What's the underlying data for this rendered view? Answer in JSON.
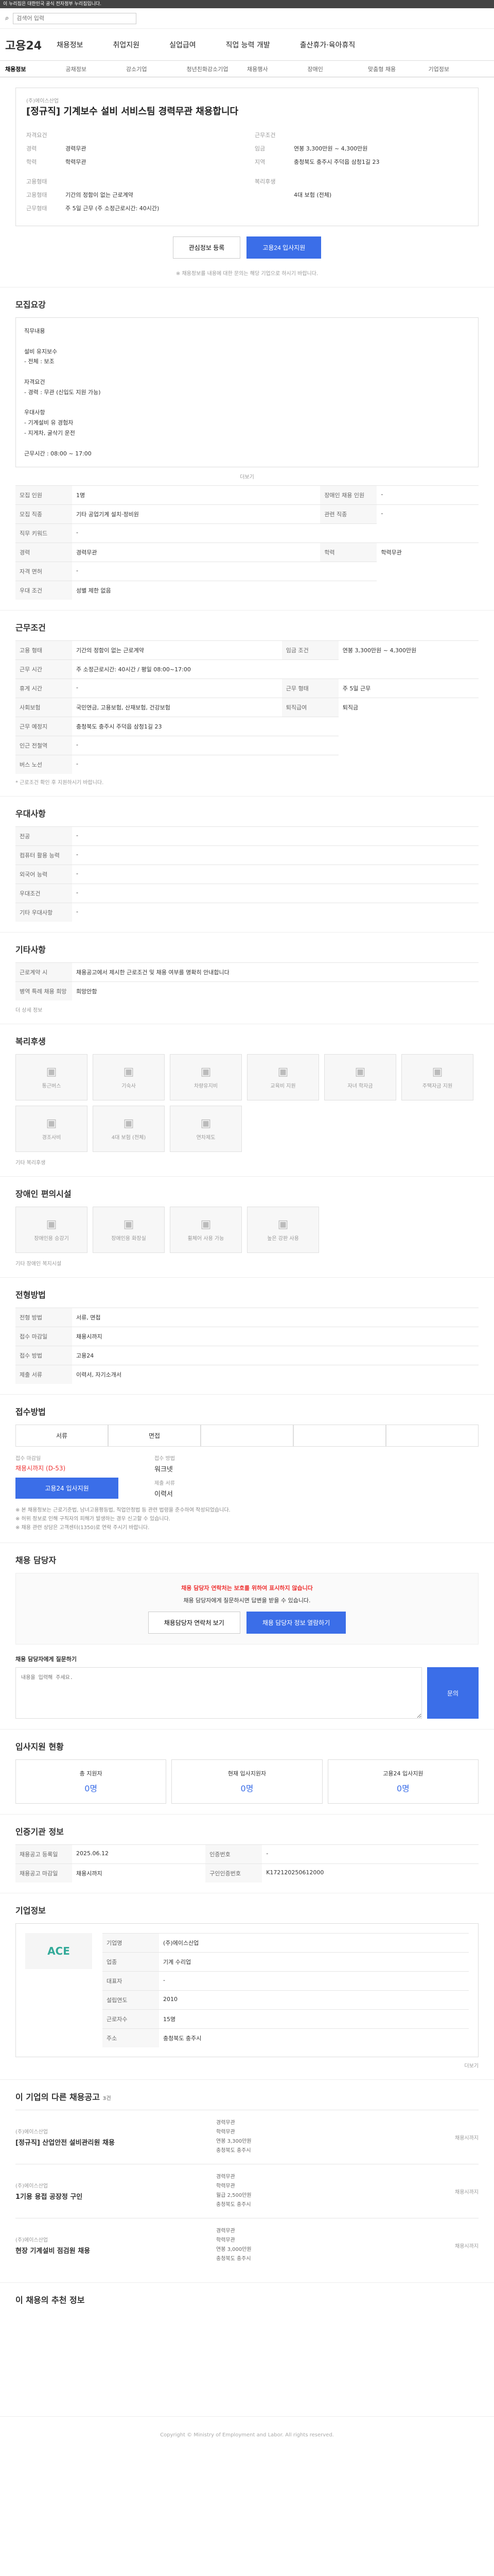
{
  "topbar": {
    "text": "이 누리집은 대한민국 공식 전자정부 누리집입니다."
  },
  "search": {
    "placeholder": "검색어 입력"
  },
  "gnb": {
    "logo": "고용24",
    "items": [
      "채용정보",
      "취업지원",
      "실업급여",
      "직업 능력 개발",
      "출산휴가·육아휴직"
    ]
  },
  "subnav": [
    "채용정보",
    "공채정보",
    "강소기업",
    "청년친화강소기업",
    "채용행사",
    "장애인",
    "맞춤형 채용",
    "기업정보"
  ],
  "job": {
    "company": "(주)에이스산업",
    "title": "[정규직] 기계보수 설비 서비스팀 경력무관 채용합니다",
    "left": {
      "label": "자격요건",
      "rows": [
        [
          "경력",
          "경력무관"
        ],
        [
          "학력",
          "학력무관"
        ]
      ]
    },
    "right": {
      "label": "근무조건",
      "rows": [
        [
          "임금",
          "연봉 3,300만원 ~ 4,300만원"
        ],
        [
          "지역",
          "충청북도 충주시 주덕읍 삼청1길 23"
        ]
      ]
    },
    "left2": {
      "label": "고용형태",
      "rows": [
        [
          "고용형태",
          "기간의 정함이 없는 근로계약"
        ],
        [
          "근무형태",
          "주 5일 근무 (주 소정근로시간: 40시간)"
        ]
      ]
    },
    "right2": {
      "label": "복리후생",
      "rows": [
        [
          "",
          "4대 보험 (전체)"
        ]
      ]
    },
    "btn_scrap": "관심정보 등록",
    "btn_apply": "고용24 입사지원",
    "notice": "※ 채용정보를 내용에 대한 문의는 해당 기업으로 하시기 바랍니다."
  },
  "recruit": {
    "title": "모집요강",
    "desc": "직무내용\n\n설비 유지보수\n - 전체 : 보조\n\n자격요건\n - 경력 : 무관 (신입도 지원 가능)\n\n우대사항\n - 기계설비 유 경험자\n - 지게차, 굴삭기 운전\n\n근무시간 : 08:00 ~ 17:00",
    "more": "더보기",
    "rows": [
      [
        "모집 인원",
        "1명",
        "장애인 채용 인원",
        "-"
      ],
      [
        "모집 직종",
        "기타 공업기계 설치·정비원",
        "관련 직종",
        "-"
      ],
      [
        "직무 키워드",
        "-",
        "",
        ""
      ],
      [
        "경력",
        "경력무관",
        "학력",
        "학력무관"
      ],
      [
        "자격 면허",
        "-",
        "",
        ""
      ],
      [
        "우대 조건",
        "성별 제한 없음",
        "",
        ""
      ]
    ]
  },
  "workcond": {
    "title": "근무조건",
    "rows": [
      [
        "고용 형태",
        "기간의 정함이 없는 근로계약",
        "임금 조건",
        "연봉 3,300만원 ~ 4,300만원"
      ],
      [
        "근무 시간",
        "주 소정근로시간: 40시간 / 평일 08:00~17:00",
        "",
        ""
      ],
      [
        "휴게 시간",
        "-",
        "근무 형태",
        "주 5일 근무"
      ],
      [
        "사회보험",
        "국민연금, 고용보험, 산재보험, 건강보험",
        "퇴직급여",
        "퇴직금"
      ],
      [
        "근무 예정지",
        "충청북도 충주시 주덕읍 삼청1길 23",
        "",
        ""
      ],
      [
        "인근 전철역",
        "-",
        "",
        ""
      ],
      [
        "버스 노선",
        "-",
        "",
        ""
      ]
    ],
    "note": "* 근로조건 확인 후 지원하시기 바랍니다."
  },
  "prefer": {
    "title": "우대사항",
    "rows": [
      [
        "전공",
        "-"
      ],
      [
        "컴퓨터 활용 능력",
        "-"
      ],
      [
        "외국어 능력",
        "-"
      ],
      [
        "우대조건",
        "-"
      ],
      [
        "기타 우대사항",
        "-"
      ]
    ]
  },
  "extra": {
    "title": "기타사항",
    "rows": [
      [
        "근로계약 시",
        "채용공고에서 제시한 근로조건 및 채용 여부를 명확히 안내합니다"
      ],
      [
        "병역 특례 채용 희망",
        "희망안함"
      ]
    ],
    "link": "더 상세 정보"
  },
  "welfare": {
    "title": "복리후생",
    "items": [
      "통근버스",
      "기숙사",
      "차량유지비",
      "교육비 지원",
      "자녀 학자금",
      "주택자금 지원",
      "경조사비",
      "4대 보험 (전체)",
      "연차제도"
    ],
    "detail": "기타 복리후생"
  },
  "disabled": {
    "title": "장애인 편의시설",
    "items": [
      "장애인용 승강기",
      "장애인용 화장실",
      "휠체어 사용 가능",
      "높은 강판 사용"
    ],
    "detail": "기타 장애인 복지시설"
  },
  "apply": {
    "title": "전형방법",
    "rows": [
      [
        "전형 방법",
        "서류, 면접",
        "",
        ""
      ],
      [
        "접수 마감일",
        "채용시까지",
        "",
        ""
      ],
      [
        "접수 방법",
        "고용24",
        "",
        ""
      ],
      [
        "제출 서류",
        "이력서, 자기소개서",
        "",
        ""
      ]
    ]
  },
  "process": {
    "title": "접수방법",
    "tabs": [
      "서류",
      "면접",
      "",
      "",
      ""
    ],
    "deadline_label": "접수 마감일",
    "deadline": "채용시까지 (D-53)",
    "method_label": "접수 방법",
    "method": "워크넷",
    "apply_btn": "고용24 입사지원",
    "docs_label": "제출 서류",
    "docs": "이력서",
    "notes": [
      "※ 본 채용정보는 근로기준법, 남녀고용평등법, 직업안정법 등 관련 법령을 준수하여 작성되었습니다.",
      "※ 허위 정보로 인해 구직자의 피해가 발생하는 경우 신고할 수 있습니다.",
      "※ 채용 관련 상담은 고객센터(1350)로 연락 주시기 바랍니다."
    ]
  },
  "contact": {
    "title": "채용 담당자",
    "alert": "채용 담당자 연락처는 보호를 위하여 표시하지 않습니다",
    "alert_sub": "채용 담당자에게 질문하시면 답변을 받을 수 있습니다.",
    "btn1": "채용담당자 연락처 보기",
    "btn2": "채용 담당자 정보 열람하기",
    "q_label": "채용 담당자에게 질문하기",
    "q_placeholder": "내용을 입력해 주세요.",
    "q_btn": "문의"
  },
  "stats": {
    "title": "입사지원 현황",
    "items": [
      [
        "총 지원자",
        "0명"
      ],
      [
        "현재 입사지원자",
        "0명"
      ],
      [
        "고용24 입사지원",
        "0명"
      ]
    ]
  },
  "admin": {
    "title": "인증기관 정보",
    "rows": [
      [
        "채용공고 등록일",
        "2025.06.12",
        "인증번호",
        "-"
      ],
      [
        "채용공고 마감일",
        "채용시까지",
        "구인인증번호",
        "K172120250612000"
      ]
    ]
  },
  "company": {
    "title": "기업정보",
    "logo": "ACE",
    "rows": [
      [
        "기업명",
        "(주)에이스산업"
      ],
      [
        "업종",
        "기계 수리업"
      ],
      [
        "대표자",
        "-"
      ],
      [
        "설립연도",
        "2010"
      ],
      [
        "근로자수",
        "15명"
      ],
      [
        "주소",
        "충청북도 충주시"
      ]
    ],
    "more": "더보기"
  },
  "others": {
    "title": "이 기업의 다른 채용공고",
    "count": "3건",
    "postings": [
      {
        "company": "(주)에이스산업",
        "title": "[정규직] 산업안전 설비관리원 채용",
        "meta": [
          "경력무관",
          "학력무관",
          "연봉 3,300만원",
          "충청북도 충주시"
        ],
        "deadline": "채용시까지"
      },
      {
        "company": "(주)에이스산업",
        "title": "1기용 용접 공장정 구인",
        "meta": [
          "경력무관",
          "학력무관",
          "월급 2,500만원",
          "충청북도 충주시"
        ],
        "deadline": "채용시까지"
      },
      {
        "company": "(주)에이스산업",
        "title": "현장 기계설비 점검원 채용",
        "meta": [
          "경력무관",
          "학력무관",
          "연봉 3,000만원",
          "충청북도 충주시"
        ],
        "deadline": "채용시까지"
      }
    ]
  },
  "recommend": {
    "title": "이 채용의 추천 정보"
  },
  "footer": "Copyright © Ministry of Employment and Labor. All rights reserved."
}
